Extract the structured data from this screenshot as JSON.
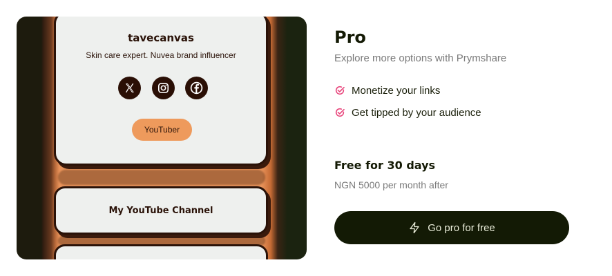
{
  "preview": {
    "username": "tavecanvas",
    "bio": "Skin care expert. Nuvea brand influencer",
    "socials": [
      {
        "icon": "x-twitter-icon"
      },
      {
        "icon": "instagram-icon"
      },
      {
        "icon": "facebook-icon"
      }
    ],
    "role_label": "YouTuber",
    "links": [
      "My YouTube Channel"
    ]
  },
  "plan": {
    "title": "Pro",
    "subtitle": "Explore more options with Prymshare",
    "features": [
      {
        "label": "Monetize your links",
        "icon": "check-circle-icon"
      },
      {
        "label": "Get tipped by your audience",
        "icon": "check-circle-icon"
      }
    ],
    "trial_title": "Free for 30 days",
    "trial_subtitle": "NGN 5000 per month after",
    "cta_label": "Go pro for free",
    "cta_icon": "lightning-bolt-icon"
  },
  "colors": {
    "accent_check": "#e8467c",
    "cta_bg": "#131a05",
    "preview_orange": "#e9935a",
    "pill_orange": "#ee9a5c",
    "card_border": "#2a1208"
  }
}
